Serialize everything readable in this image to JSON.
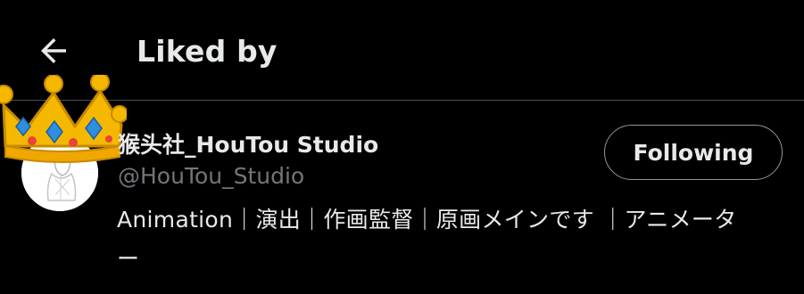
{
  "header": {
    "title": "Liked by",
    "back_icon": "arrow-left-icon"
  },
  "user": {
    "display_name": "猴头社_HouTou Studio",
    "handle": "@HouTou_Studio",
    "bio": "Animation｜演出｜作画監督｜原画メインです ｜アニメーター",
    "follow_button_label": "Following",
    "avatar_icon": "avatar-sketch",
    "badge_icon": "crown-icon"
  },
  "colors": {
    "background": "#000000",
    "text_primary": "#e7e9ea",
    "text_secondary": "#71767b",
    "divider": "#4a4d52",
    "button_border": "#8b98a5",
    "crown_gold": "#f5b800",
    "crown_gem": "#2e8fe0"
  }
}
